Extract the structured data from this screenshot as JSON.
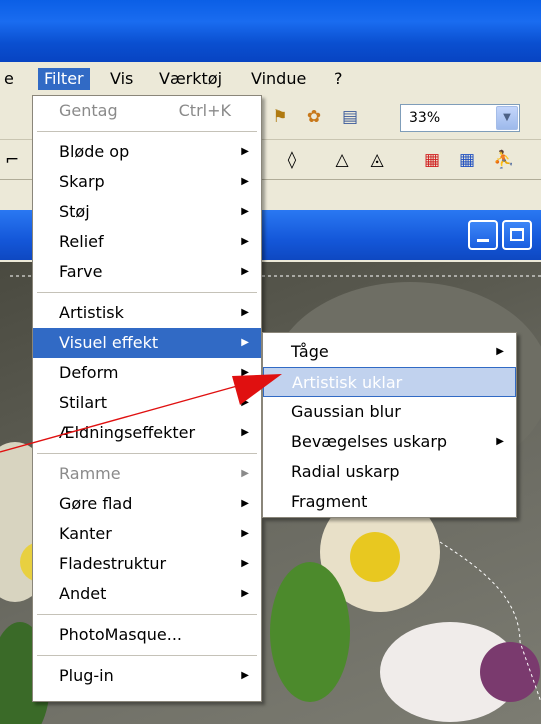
{
  "menubar": {
    "items": [
      {
        "label": "e"
      },
      {
        "label": "Filter"
      },
      {
        "label": "Vis"
      },
      {
        "label": "Værktøj"
      },
      {
        "label": "Vindue"
      },
      {
        "label": "?"
      }
    ]
  },
  "toolbar": {
    "zoom": "33%"
  },
  "filter_menu": {
    "repeat": {
      "label": "Gentag",
      "shortcut": "Ctrl+K"
    },
    "group1": [
      {
        "label": "Bløde op"
      },
      {
        "label": "Skarp"
      },
      {
        "label": "Støj"
      },
      {
        "label": "Relief"
      },
      {
        "label": "Farve"
      }
    ],
    "group2": [
      {
        "label": "Artistisk"
      },
      {
        "label": "Visuel effekt"
      },
      {
        "label": "Deform"
      },
      {
        "label": "Stilart"
      },
      {
        "label": "Ældningseffekter"
      }
    ],
    "group3": [
      {
        "label": "Ramme"
      },
      {
        "label": "Gøre flad"
      },
      {
        "label": "Kanter"
      },
      {
        "label": "Fladestruktur"
      },
      {
        "label": "Andet"
      }
    ],
    "photomasque": {
      "label": "PhotoMasque..."
    },
    "plugin": {
      "label": "Plug-in"
    }
  },
  "submenu": {
    "items": [
      {
        "label": "Tåge"
      },
      {
        "label": "Artistisk uklar"
      },
      {
        "label": "Gaussian blur"
      },
      {
        "label": "Bevægelses uskarp"
      },
      {
        "label": "Radial uskarp"
      },
      {
        "label": "Fragment"
      }
    ]
  },
  "colors": {
    "highlight": "#316ac5",
    "title_blue": "#0b5fe6",
    "arrow_red": "#e01010"
  },
  "icons": [
    "submenu-arrow-icon",
    "camera-icon",
    "gear-icon",
    "window-icon",
    "triangle-icon",
    "palette-icon"
  ]
}
